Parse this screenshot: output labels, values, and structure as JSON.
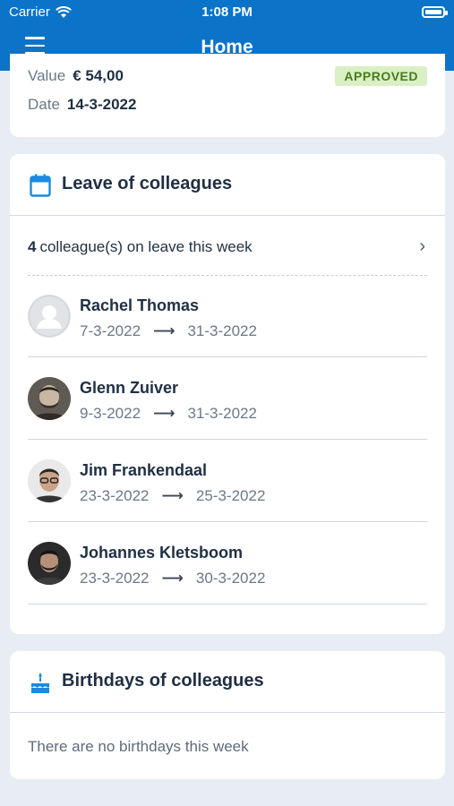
{
  "status_bar": {
    "carrier": "Carrier",
    "time": "1:08 PM"
  },
  "header": {
    "title": "Home",
    "menu_icon": "hamburger-menu-icon",
    "color": "#0b73c8"
  },
  "expense": {
    "value_label": "Value",
    "value": "€ 54,00",
    "date_label": "Date",
    "date": "14-3-2022",
    "status": "APPROVED"
  },
  "leave": {
    "title": "Leave of colleagues",
    "icon": "calendar-icon",
    "summary_count": "4",
    "summary_text": "colleague(s) on leave this week",
    "colleagues": [
      {
        "name": "Rachel Thomas",
        "from": "7-3-2022",
        "to": "31-3-2022"
      },
      {
        "name": "Glenn Zuiver",
        "from": "9-3-2022",
        "to": "31-3-2022"
      },
      {
        "name": "Jim Frankendaal",
        "from": "23-3-2022",
        "to": "25-3-2022"
      },
      {
        "name": "Johannes Kletsboom",
        "from": "23-3-2022",
        "to": "30-3-2022"
      }
    ]
  },
  "birthdays": {
    "title": "Birthdays of colleagues",
    "icon": "birthday-cake-icon",
    "empty_text": "There are no birthdays this week"
  }
}
